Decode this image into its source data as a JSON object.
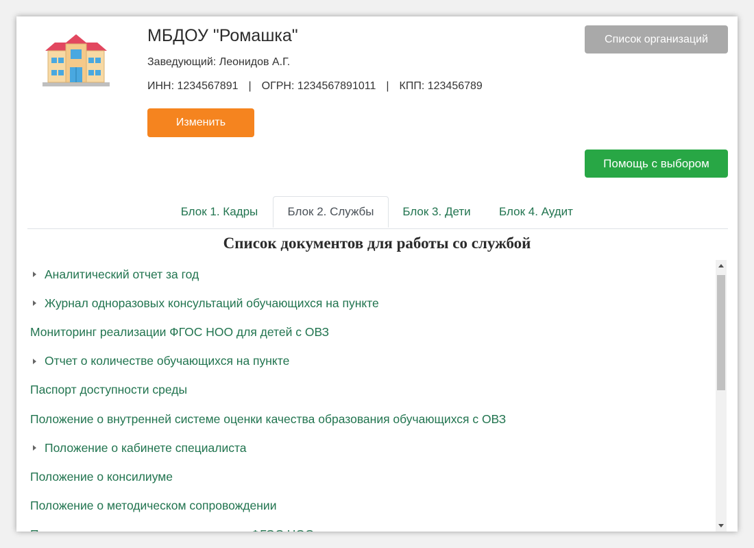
{
  "org": {
    "name": "МБДОУ \"Ромашка\"",
    "head": "Заведующий: Леонидов А.Г.",
    "inn": "ИНН: 1234567891",
    "ogrn": "ОГРН: 1234567891011",
    "kpp": "КПП: 123456789",
    "separator": "|"
  },
  "buttons": {
    "edit": "Изменить",
    "org_list": "Список организаций",
    "help": "Помощь с выбором"
  },
  "tabs": [
    {
      "label": "Блок 1. Кадры",
      "active": false
    },
    {
      "label": "Блок 2. Службы",
      "active": true
    },
    {
      "label": "Блок 3. Дети",
      "active": false
    },
    {
      "label": "Блок 4. Аудит",
      "active": false
    }
  ],
  "section_title": "Список документов для работы со службой",
  "documents": [
    {
      "label": "Аналитический отчет за год",
      "expandable": true
    },
    {
      "label": "Журнал одноразовых консультаций обучающихся на пункте",
      "expandable": true
    },
    {
      "label": "Мониторинг реализации ФГОС НОО для детей с ОВЗ",
      "expandable": false
    },
    {
      "label": "Отчет о количестве обучающихся на пункте",
      "expandable": true
    },
    {
      "label": "Паспорт доступности среды",
      "expandable": false
    },
    {
      "label": "Положение о внутренней системе оценки качества образования обучающихся с ОВЗ",
      "expandable": false
    },
    {
      "label": "Положение о кабинете специалиста",
      "expandable": true
    },
    {
      "label": "Положение о консилиуме",
      "expandable": false
    },
    {
      "label": "Положение о методическом сопровождении",
      "expandable": false
    },
    {
      "label": "Положение о мониторинге реализации ФГОС НОО",
      "expandable": false
    }
  ],
  "icons": {
    "logo": "building-icon",
    "expand": "caret-right-icon",
    "scroll_up": "scroll-up-arrow-icon",
    "scroll_down": "scroll-down-arrow-icon"
  },
  "colors": {
    "edit_button": "#f5841f",
    "org_list_button": "#a9a9a9",
    "help_button": "#28a745",
    "link_text": "#21744f"
  }
}
